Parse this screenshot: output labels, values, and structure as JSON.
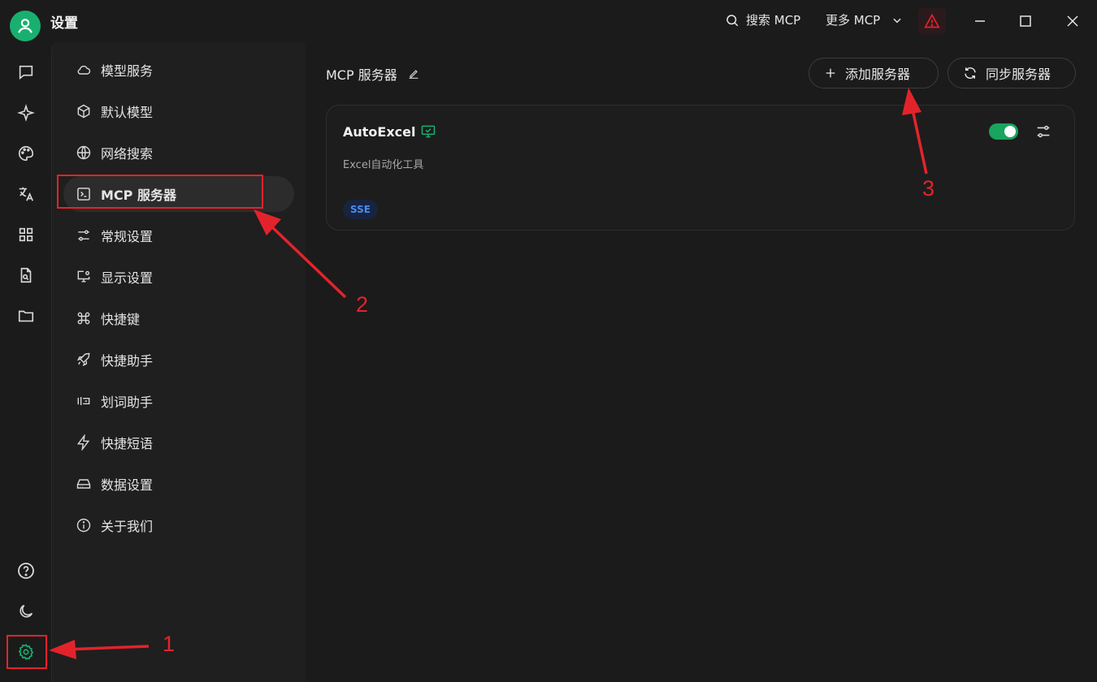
{
  "app": {
    "title": "设置"
  },
  "titlebar": {
    "search_mcp": "搜索 MCP",
    "more_mcp": "更多 MCP"
  },
  "rail": {
    "icons": [
      "chat-icon",
      "sparkle-icon",
      "palette-icon",
      "translate-icon",
      "apps-grid-icon",
      "file-search-icon",
      "folder-icon"
    ],
    "bottom_icons": [
      "help-icon",
      "moon-icon",
      "gear-icon"
    ]
  },
  "sidebar": {
    "items": [
      {
        "label": "模型服务",
        "icon": "cloud-icon"
      },
      {
        "label": "默认模型",
        "icon": "cube-icon"
      },
      {
        "label": "网络搜索",
        "icon": "globe-icon"
      },
      {
        "label": "MCP 服务器",
        "icon": "terminal-icon",
        "active": true
      },
      {
        "label": "常规设置",
        "icon": "sliders-icon"
      },
      {
        "label": "显示设置",
        "icon": "monitor-gear-icon"
      },
      {
        "label": "快捷键",
        "icon": "command-icon"
      },
      {
        "label": "快捷助手",
        "icon": "rocket-icon"
      },
      {
        "label": "划词助手",
        "icon": "text-select-icon"
      },
      {
        "label": "快捷短语",
        "icon": "zap-icon"
      },
      {
        "label": "数据设置",
        "icon": "hard-drive-icon"
      },
      {
        "label": "关于我们",
        "icon": "info-icon"
      }
    ]
  },
  "main": {
    "section_title": "MCP 服务器",
    "add_button": "添加服务器",
    "sync_button": "同步服务器",
    "server": {
      "name": "AutoExcel",
      "description": "Excel自动化工具",
      "type_badge": "SSE",
      "enabled": true
    }
  },
  "annotations": {
    "n1": "1",
    "n2": "2",
    "n3": "3"
  },
  "colors": {
    "accent": "#18a55e",
    "annotation_red": "#e3232b",
    "badge_text": "#4a8cf0"
  }
}
